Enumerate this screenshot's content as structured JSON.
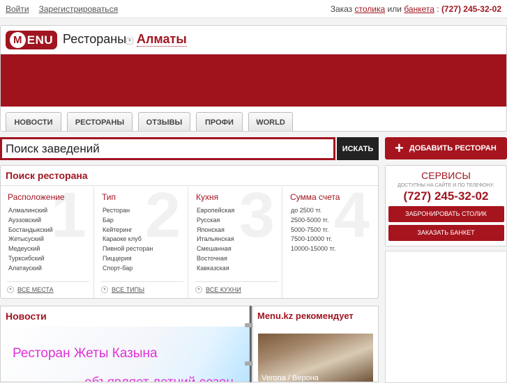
{
  "topbar": {
    "login": "Войти",
    "register": "Зарегистрироваться",
    "order_text1": "Заказ",
    "order_table": "столика",
    "order_or": "или",
    "order_banquet": "банкета",
    "order_colon": ":",
    "phone": "(727) 245-32-02"
  },
  "header": {
    "logo_letter": "M",
    "logo_text": "ENU",
    "title": "Рестораны",
    "city": "Алматы"
  },
  "tabs": [
    "НОВОСТИ",
    "РЕСТОРАНЫ",
    "ОТЗЫВЫ",
    "ПРОФИ",
    "WORLD"
  ],
  "search": {
    "value": "Поиск заведений",
    "button": "ИСКАТЬ"
  },
  "add_restaurant": "ДОБАВИТЬ РЕСТОРАН",
  "finder": {
    "title": "Поиск ресторана",
    "columns": [
      {
        "num": "1",
        "title": "Расположение",
        "items": [
          "Алмалинский",
          "Ауэзовский",
          "Бостандыкский",
          "Жетысуский",
          "Медеуский",
          "Турксибский",
          "Алатауский"
        ],
        "all": "ВСЕ МЕСТА"
      },
      {
        "num": "2",
        "title": "Тип",
        "items": [
          "Ресторан",
          "Бар",
          "Кейтеринг",
          "Караоке клуб",
          "Пивной ресторан",
          "Пиццерия",
          "Спорт-бар"
        ],
        "all": "ВСЕ ТИПЫ"
      },
      {
        "num": "3",
        "title": "Кухня",
        "items": [
          "Европейская",
          "Русская",
          "Японская",
          "Итальянская",
          "Смешанная",
          "Восточная",
          "Кавказская"
        ],
        "all": "ВСЕ КУХНИ"
      },
      {
        "num": "4",
        "title": "Сумма счета",
        "items": [
          "до 2500 тг.",
          "2500-5000 тг.",
          "5000-7500 тг.",
          "7500-10000 тг.",
          "10000-15000 тг."
        ],
        "all": ""
      }
    ]
  },
  "services": {
    "title": "СЕРВИСЫ",
    "subtitle": "ДОСТУПНЫ НА САЙТЕ И ПО ТЕЛЕФОНУ:",
    "phone": "(727) 245-32-02",
    "book_table": "ЗАБРОНИРОВАТЬ СТОЛИК",
    "order_banquet": "ЗАКАЗАТЬ БАНКЕТ"
  },
  "news": {
    "title": "Новости",
    "caption": "Ресторан Жеты Казына",
    "caption2": "объявляет летний сезон"
  },
  "recommend": {
    "title": "Menu.kz рекомендует",
    "photo_caption": "Verona / Верона"
  },
  "colors": {
    "brand": "#a01520",
    "banner": "#a0121c"
  }
}
